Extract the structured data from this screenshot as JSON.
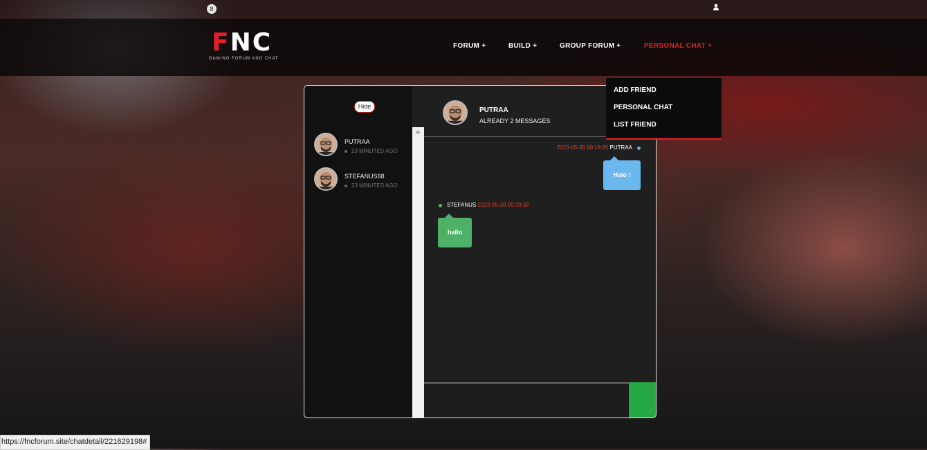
{
  "topbar": {
    "notification_count": "8",
    "user_icon": "user-icon"
  },
  "brand": {
    "logo_f": "F",
    "logo_nc": "NC",
    "tagline": "GAMING FORUM AND CHAT",
    "accent_color": "#e0202b"
  },
  "nav": {
    "items": [
      {
        "label": "FORUM +"
      },
      {
        "label": "BUILD +"
      },
      {
        "label": "GROUP FORUM +"
      },
      {
        "label": "PERSONAL CHAT +"
      }
    ],
    "active": "PERSONAL CHAT +"
  },
  "dropdown": {
    "items": [
      {
        "label": "ADD FRIEND"
      },
      {
        "label": "PERSONAL CHAT"
      },
      {
        "label": "LIST FRIEND"
      }
    ]
  },
  "sidebar": {
    "hide_label": "Hide",
    "contacts": [
      {
        "name": "PUTRAA",
        "last_seen": "23 MINUTES AGO"
      },
      {
        "name": "STEFANUS68",
        "last_seen": "23 MINUTES AGO"
      }
    ]
  },
  "chat": {
    "header_name": "PUTRAA",
    "header_sub": "ALREADY 2 MESSAGES",
    "messages": [
      {
        "time": "2023-05-30 00:19:25",
        "sender": "PUTRAA",
        "text": "Halo !",
        "color": "#6ab8ee"
      },
      {
        "time": "2023-05-30 00:19:32",
        "sender": "STEFANUS",
        "text": "hallo",
        "color": "#4fb068"
      }
    ],
    "send_color": "#28a745"
  },
  "status_bar": {
    "url": "https://fncforum.site/chatdetail/221629198#"
  }
}
